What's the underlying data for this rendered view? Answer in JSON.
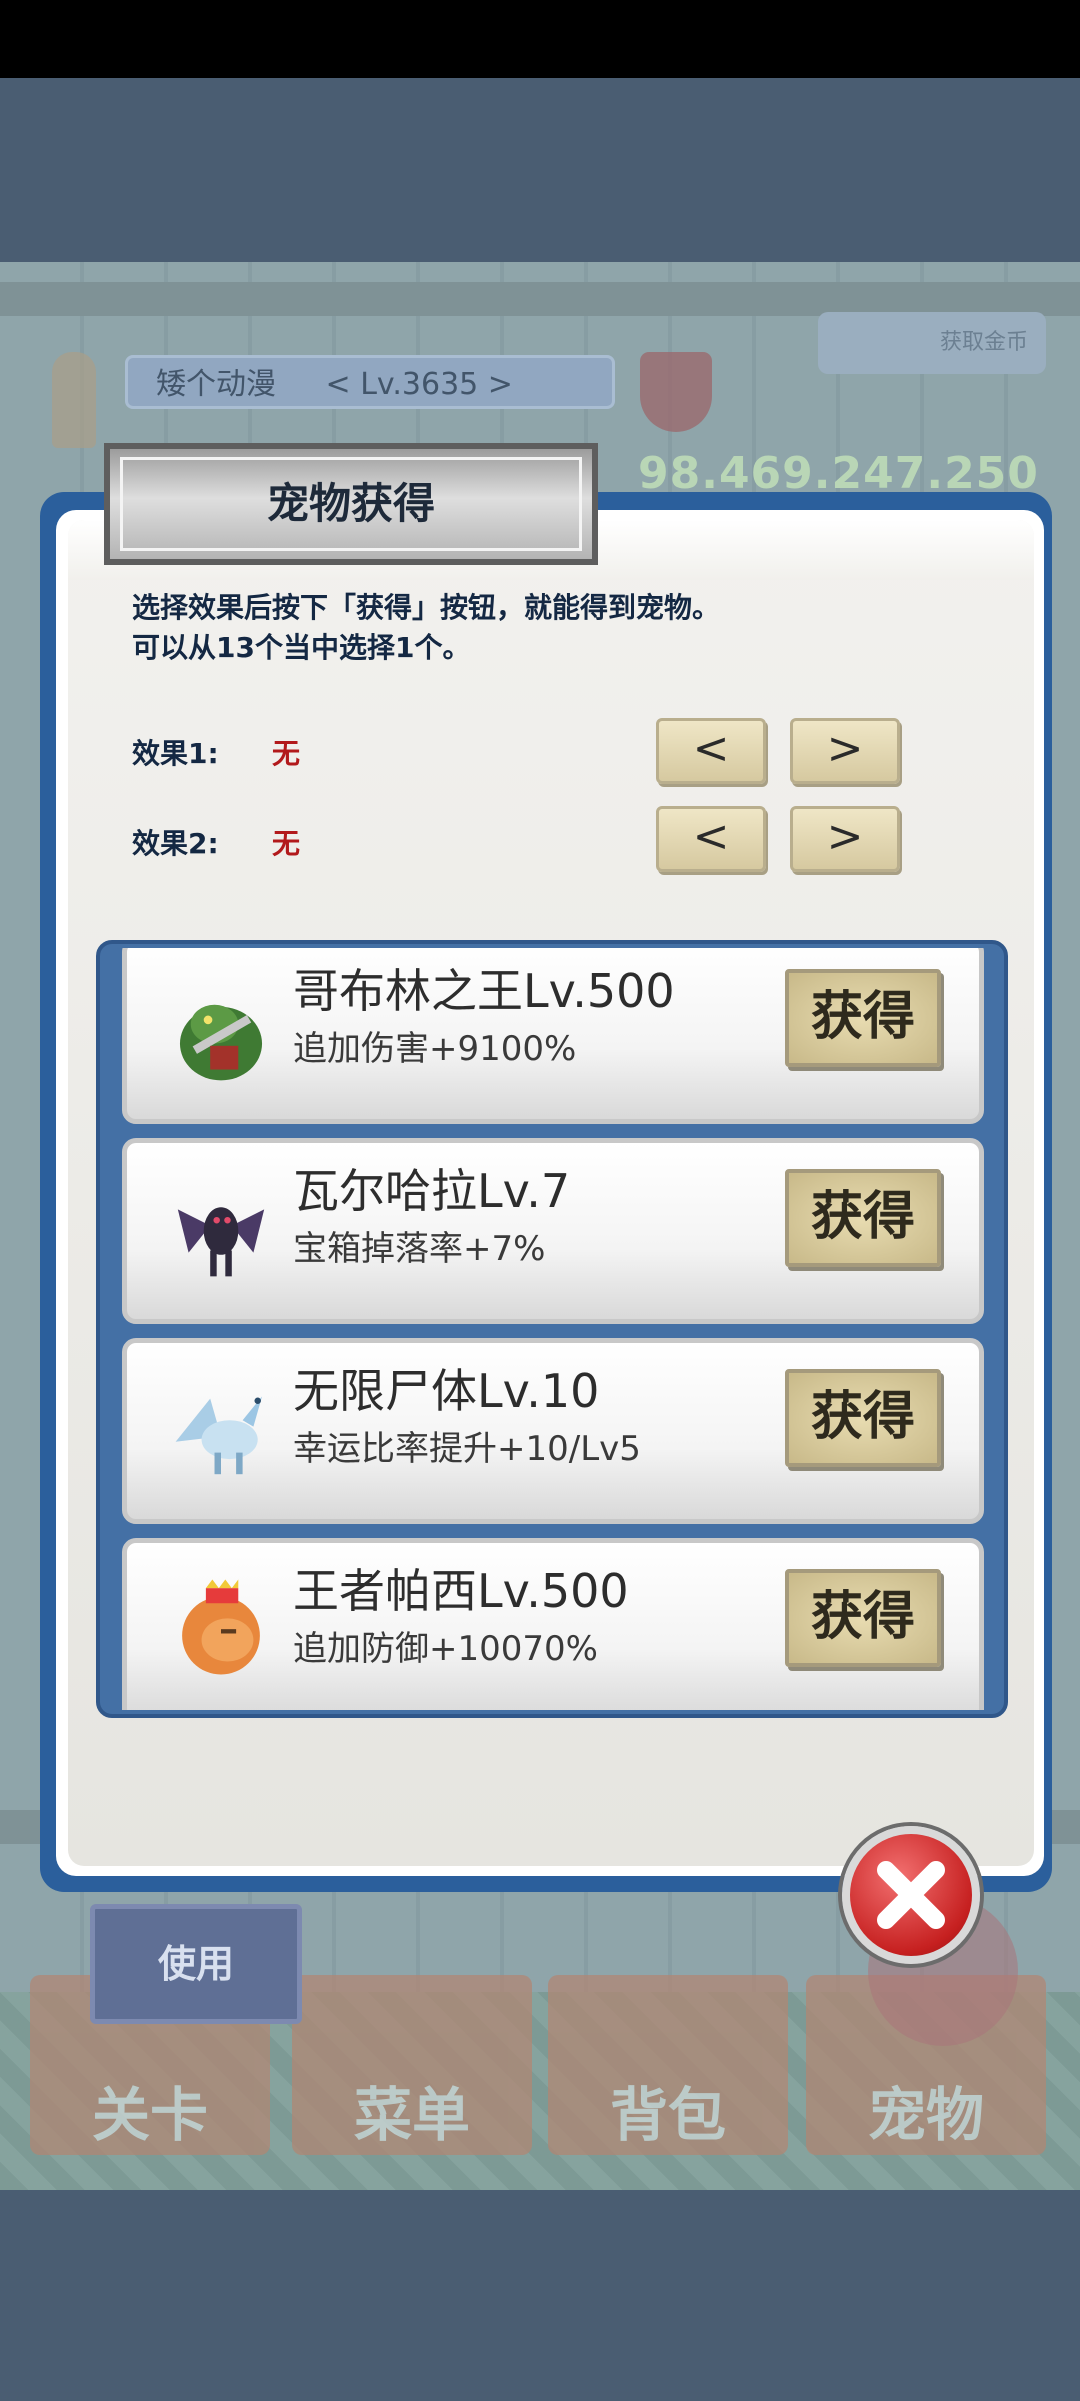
{
  "hud": {
    "player_name": "矮个动漫",
    "player_level": "< Lv.3635 >",
    "money": "98.469.247.250",
    "top_right_button": "获取金币"
  },
  "bottom_tabs": [
    "关卡",
    "菜单",
    "背包",
    "宠物"
  ],
  "use_button": "使用",
  "dialog": {
    "title": "宠物获得",
    "intro_line1": "选择效果后按下「获得」按钮，就能得到宠物。",
    "intro_line2": "可以从13个当中选择1个。",
    "effects": [
      {
        "label": "效果1:",
        "value": "无",
        "prev": "<",
        "next": ">"
      },
      {
        "label": "效果2:",
        "value": "无",
        "prev": "<",
        "next": ">"
      }
    ],
    "pets": [
      {
        "name": "哥布林之王Lv.500",
        "effect": "追加伤害+9100%",
        "button": "获得",
        "icon": "goblin-king-icon"
      },
      {
        "name": "瓦尔哈拉Lv.7",
        "effect": "宝箱掉落率+7%",
        "button": "获得",
        "icon": "valhalla-demon-icon"
      },
      {
        "name": "无限尸体Lv.10",
        "effect": "幸运比率提升+10/Lv5",
        "button": "获得",
        "icon": "ice-dragon-icon"
      },
      {
        "name": "王者帕西Lv.500",
        "effect": "追加防御+10070%",
        "button": "获得",
        "icon": "king-lion-icon"
      }
    ]
  },
  "colors": {
    "dialog_border": "#2b5f9c",
    "list_bg": "#4470a5",
    "effect_value": "#b2191b",
    "close_button": "#c62020"
  }
}
